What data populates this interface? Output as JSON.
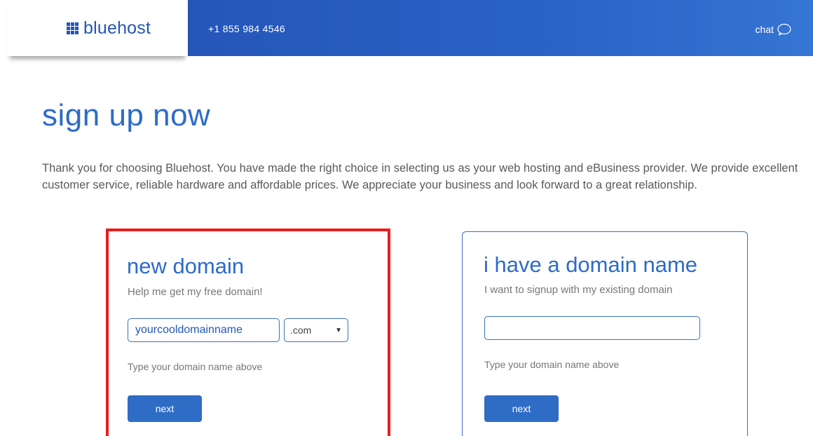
{
  "header": {
    "logo_text": "bluehost",
    "phone": "+1 855 984 4546",
    "chat_label": "chat",
    "brand_color": "#2456b8"
  },
  "main": {
    "title": "sign up now",
    "intro": "Thank you for choosing Bluehost. You have made the right choice in selecting us as your web hosting and eBusiness provider. We provide excellent customer service, reliable hardware and affordable prices. We appreciate your business and look forward to a great relationship."
  },
  "new_domain": {
    "title": "new domain",
    "subtitle": "Help me get my free domain!",
    "input_value": "yourcooldomainname",
    "tld_selected": ".com",
    "hint": "Type your domain name above",
    "button_label": "next",
    "highlight_color": "#ee1c1c"
  },
  "existing_domain": {
    "title": "i have a domain name",
    "subtitle": "I want to signup with my existing domain",
    "input_value": "",
    "hint": "Type your domain name above",
    "button_label": "next"
  },
  "icons": {
    "logo": "grid-logo-icon",
    "chat": "chat-bubble-icon",
    "select_arrow": "triangle-down-icon"
  }
}
